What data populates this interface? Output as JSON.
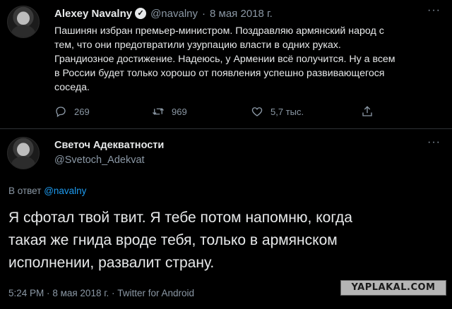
{
  "tweet": {
    "author_name": "Alexey Navalny",
    "verified_icon": "✓",
    "handle": "@navalny",
    "separator": "·",
    "date": "8 мая 2018 г.",
    "more_icon": "···",
    "text": "Пашинян избран премьер-министром. Поздравляю армянский народ с\nтем, что они предотвратили узурпацию власти в одних руках.\nГрандиозное достижение. Надеюсь, у Армении всё получится. Ну а всем\nв России будет только хорошо от появления успешно развивающегося\nсоседа.",
    "actions": {
      "reply_count": "269",
      "retweet_count": "969",
      "like_count": "5,7 тыс.",
      "reply_icon": "reply-icon",
      "retweet_icon": "retweet-icon",
      "like_icon": "heart-icon",
      "share_icon": "share-icon"
    }
  },
  "reply": {
    "author_name": "Светоч Адекватности",
    "handle": "@Svetoch_Adekvat",
    "more_icon": "···",
    "reply_to_prefix": "В ответ",
    "reply_to_mention": "@navalny",
    "text": "Я сфотал твой твит. Я тебе потом напомню, когда\nтакая же гнида вроде тебя, только в армянском\nисполнении, развалит страну.",
    "time": "5:24 PM",
    "separator": "·",
    "date": "8 мая 2018 г.",
    "client": "Twitter for Android"
  },
  "watermark": "YAPLAKAL.COM",
  "colors": {
    "background": "#000000",
    "text": "#e7e9ea",
    "secondary": "#8b98a5",
    "link": "#1d9bf0",
    "divider": "#2f3336"
  }
}
